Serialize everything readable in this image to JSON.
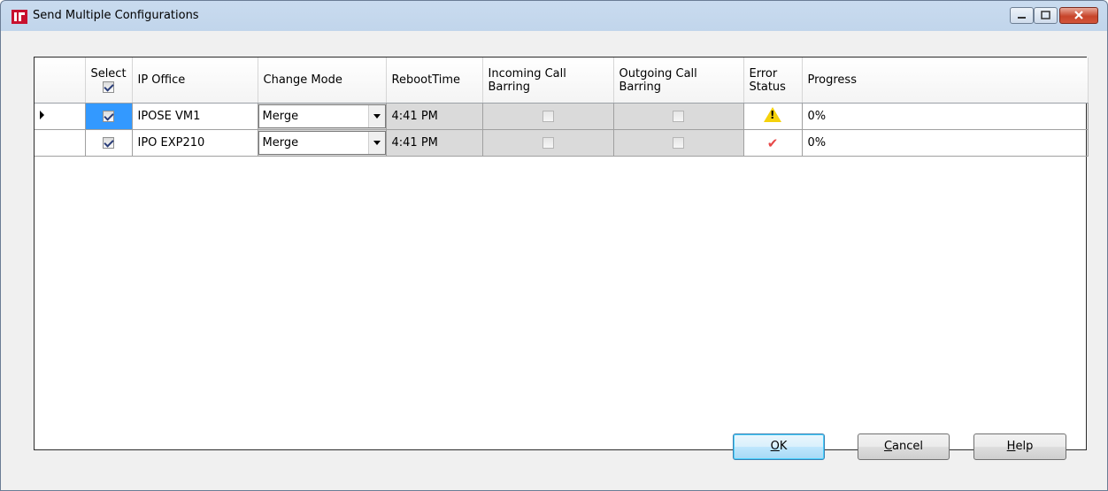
{
  "window": {
    "title": "Send Multiple Configurations"
  },
  "columns": {
    "select": "Select",
    "ip_office": "IP Office",
    "change_mode": "Change Mode",
    "reboot_time": "RebootTime",
    "incoming": "Incoming Call Barring",
    "outgoing": "Outgoing Call Barring",
    "error_status": "Error Status",
    "progress": "Progress"
  },
  "select_all_checked": true,
  "rows": [
    {
      "selected": true,
      "ip_office": "IPOSE VM1",
      "change_mode": "Merge",
      "reboot_time": "4:41 PM",
      "incoming": false,
      "outgoing": false,
      "error_status": "warning-icon",
      "progress": "0%"
    },
    {
      "selected": true,
      "ip_office": "IPO EXP210",
      "change_mode": "Merge",
      "reboot_time": "4:41 PM",
      "incoming": false,
      "outgoing": false,
      "error_status": "checkmark-icon",
      "progress": "0%"
    }
  ],
  "buttons": {
    "ok": {
      "mnemonic": "O",
      "rest": "K"
    },
    "cancel": {
      "mnemonic": "C",
      "rest": "ancel"
    },
    "help": {
      "mnemonic": "H",
      "rest": "elp"
    }
  },
  "colors": {
    "selection": "#3399ff",
    "warning": "#f5d20c",
    "ok_check": "#e84848"
  }
}
